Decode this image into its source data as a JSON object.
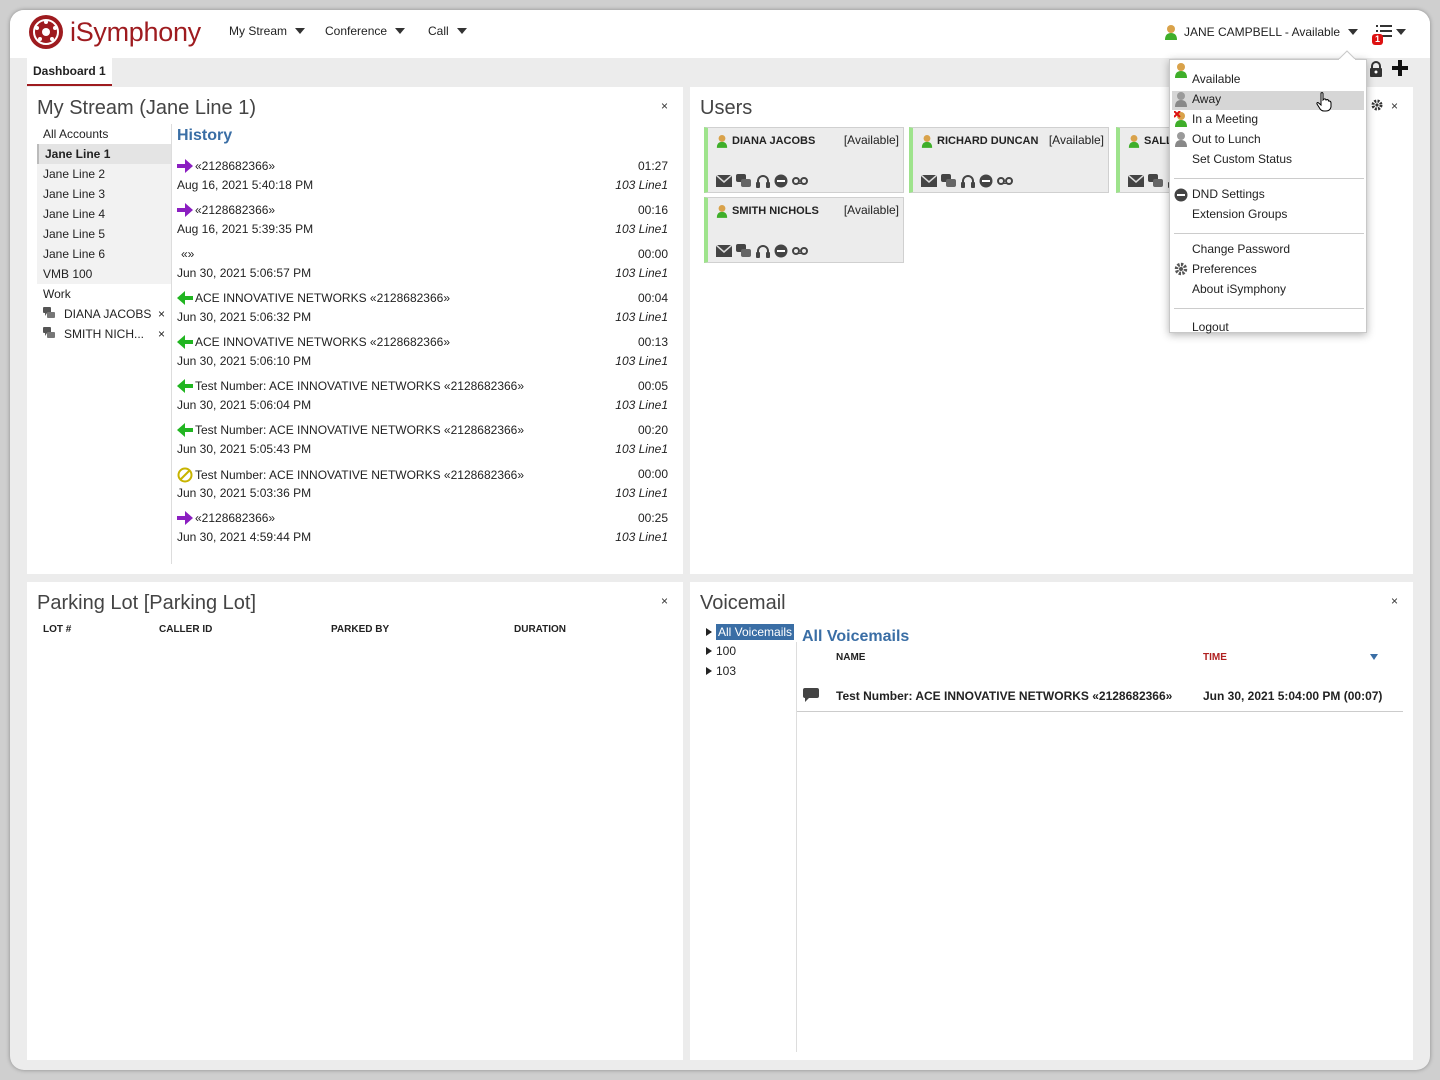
{
  "app": {
    "name": "iSymphony"
  },
  "nav": {
    "menus": [
      "My Stream",
      "Conference",
      "Call"
    ]
  },
  "header": {
    "user_status": "JANE CAMPBELL - Available",
    "notification_count": "1"
  },
  "tabs": {
    "dashboard": "Dashboard 1"
  },
  "my_stream": {
    "title": "My Stream (Jane Line 1)",
    "close": "×",
    "accounts_header": "All Accounts",
    "lines": [
      "Jane Line 1",
      "Jane Line 2",
      "Jane Line 3",
      "Jane Line 4",
      "Jane Line 5",
      "Jane Line 6",
      "VMB 100"
    ],
    "selected_line": "Jane Line 1",
    "work_header": "Work",
    "work_items": [
      {
        "name": "DIANA JACOBS",
        "remove": "×"
      },
      {
        "name": "SMITH NICH...",
        "remove": "×"
      }
    ],
    "history_title": "History",
    "history": [
      {
        "icon": "outgoing-call-icon",
        "caller": "«2128682366»",
        "datetime": "Aug 16, 2021 5:40:18 PM",
        "duration": "01:27",
        "line": "103 Line1"
      },
      {
        "icon": "outgoing-call-icon",
        "caller": "«2128682366»",
        "datetime": "Aug 16, 2021 5:39:35 PM",
        "duration": "00:16",
        "line": "103 Line1"
      },
      {
        "icon": "",
        "caller": "«»",
        "datetime": "Jun 30, 2021 5:06:57 PM",
        "duration": "00:00",
        "line": "103 Line1"
      },
      {
        "icon": "incoming-call-icon",
        "caller": "ACE INNOVATIVE NETWORKS «2128682366»",
        "datetime": "Jun 30, 2021 5:06:32 PM",
        "duration": "00:04",
        "line": "103 Line1"
      },
      {
        "icon": "incoming-call-icon",
        "caller": "ACE INNOVATIVE NETWORKS «2128682366»",
        "datetime": "Jun 30, 2021 5:06:10 PM",
        "duration": "00:13",
        "line": "103 Line1"
      },
      {
        "icon": "incoming-call-icon",
        "caller": "Test Number: ACE INNOVATIVE NETWORKS «2128682366»",
        "datetime": "Jun 30, 2021 5:06:04 PM",
        "duration": "00:05",
        "line": "103 Line1"
      },
      {
        "icon": "incoming-call-icon",
        "caller": "Test Number: ACE INNOVATIVE NETWORKS «2128682366»",
        "datetime": "Jun 30, 2021 5:05:43 PM",
        "duration": "00:20",
        "line": "103 Line1"
      },
      {
        "icon": "missed-call-icon",
        "caller": "Test Number: ACE INNOVATIVE NETWORKS «2128682366»",
        "datetime": "Jun 30, 2021 5:03:36 PM",
        "duration": "00:00",
        "line": "103 Line1"
      },
      {
        "icon": "outgoing-call-icon",
        "caller": "«2128682366»",
        "datetime": "Jun 30, 2021 4:59:44 PM",
        "duration": "00:25",
        "line": "103 Line1"
      }
    ]
  },
  "users": {
    "title": "Users",
    "close": "×",
    "cards": [
      {
        "name": "DIANA JACOBS",
        "status": "[Available]"
      },
      {
        "name": "RICHARD DUNCAN",
        "status": "[Available]"
      },
      {
        "name": "SALL",
        "status": ""
      },
      {
        "name": "SMITH NICHOLS",
        "status": "[Available]"
      }
    ]
  },
  "parking_lot": {
    "title": "Parking Lot [Parking Lot]",
    "close": "×",
    "columns": [
      "LOT #",
      "CALLER ID",
      "PARKED BY",
      "DURATION"
    ]
  },
  "voicemail": {
    "title": "Voicemail",
    "close": "×",
    "tree": [
      "All Voicemails",
      "100",
      "103"
    ],
    "list_title": "All Voicemails",
    "columns": {
      "name": "NAME",
      "time": "TIME"
    },
    "rows": [
      {
        "name": "Test Number: ACE INNOVATIVE NETWORKS «2128682366»",
        "time": "Jun 30, 2021 5:04:00 PM (00:07)"
      }
    ]
  },
  "status_menu": {
    "items": [
      "Available",
      "Away",
      "In a Meeting",
      "Out to Lunch",
      "Set Custom Status"
    ],
    "highlighted": "Away",
    "settings": [
      "DND Settings",
      "Extension Groups"
    ],
    "account": [
      "Change Password",
      "Preferences",
      "About iSymphony"
    ],
    "logout": "Logout"
  },
  "colors": {
    "brand": "#9e1b1f",
    "history_title": "#3a6ea5",
    "incoming": "#21b521",
    "outgoing": "#8b1fc1",
    "missed": "#c8b400",
    "available_bar": "#9ee38c",
    "time_header": "#b02020"
  }
}
